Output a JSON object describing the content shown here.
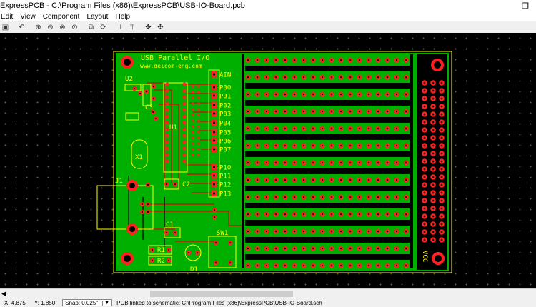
{
  "window": {
    "title": "ExpressPCB - C:\\Program Files (x86)\\ExpressPCB\\USB-IO-Board.pcb",
    "restore_glyph": "❐"
  },
  "menu": [
    "Edit",
    "View",
    "Component",
    "Layout",
    "Help"
  ],
  "toolbar": {
    "buttons": [
      {
        "name": "save-icon",
        "glyph": "▣"
      },
      {
        "name": "undo-icon",
        "glyph": "↶"
      },
      {
        "name": "zoom-in-icon",
        "glyph": "⊕"
      },
      {
        "name": "zoom-out-icon",
        "glyph": "⊖"
      },
      {
        "name": "zoom-fit-icon",
        "glyph": "⊗"
      },
      {
        "name": "zoom-area-icon",
        "glyph": "⊙"
      },
      {
        "name": "layers-icon",
        "glyph": "⧉"
      },
      {
        "name": "rotate-icon",
        "glyph": "⟳"
      },
      {
        "name": "top-layer-icon",
        "glyph": "⫫"
      },
      {
        "name": "bottom-layer-icon",
        "glyph": "⫪"
      },
      {
        "name": "move-icon",
        "glyph": "✥"
      },
      {
        "name": "pan-icon",
        "glyph": "✣"
      }
    ]
  },
  "board": {
    "title_line1": "USB Parallel I/O",
    "title_line2": "www.delcom-eng.com",
    "pin_labels": [
      "AIN",
      "P00",
      "P01",
      "P02",
      "P03",
      "P04",
      "P05",
      "P06",
      "P07",
      "P10",
      "P11",
      "P12",
      "P13"
    ],
    "component_labels": {
      "u2": "U2",
      "u1": "U1",
      "x1": "X1",
      "j1": "J1",
      "c1": "C1",
      "c2": "C2",
      "c3": "C3",
      "sw1": "SW1",
      "r1": "R1",
      "r2": "R2",
      "d1": "D1",
      "vcc": "VCC"
    },
    "colors": {
      "board": "#00b000",
      "trace_red": "#e00000",
      "silk": "#ffff00",
      "pad": "#ff2020"
    }
  },
  "status": {
    "x": "X: 4.875",
    "y": "Y: 1.850",
    "snap": "Snap: 0.025\"",
    "message": "PCB linked to schematic: C:\\Program Files (x86)\\ExpressPCB\\USB-IO-Board.sch"
  }
}
